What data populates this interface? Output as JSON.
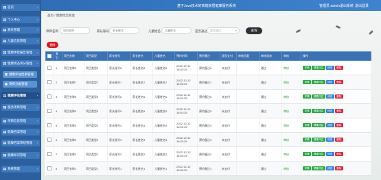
{
  "header": {
    "title": "基于Java技术的高端家居健康服务系统",
    "user": "管理员 admin",
    "exit_label": "退出系统",
    "logout_label": "退出登录"
  },
  "sidebar": {
    "items": [
      {
        "label": "首页"
      },
      {
        "label": "个人中心"
      },
      {
        "label": "家长管理"
      },
      {
        "label": "儿童信息管理"
      },
      {
        "label": "健康体检报告管理"
      },
      {
        "label": "健康状态评分管理"
      },
      {
        "label": "健康评估结果管理"
      },
      {
        "label": "项目分类管理"
      },
      {
        "label": "健康评估管理"
      },
      {
        "label": "服务项目管理"
      },
      {
        "label": "项目信息管理"
      },
      {
        "label": "健康档案管理"
      },
      {
        "label": "健康档案审核管理"
      },
      {
        "label": "健康知识管理"
      },
      {
        "label": "系统管理"
      }
    ]
  },
  "breadcrumb": {
    "home": "首页",
    "current": "健康档案管理"
  },
  "search": {
    "fields": [
      {
        "label": "项目名称",
        "placeholder": "项目名称"
      },
      {
        "label": "家长账号",
        "placeholder": "家长账号"
      },
      {
        "label": "儿童姓名",
        "placeholder": "儿童姓名"
      }
    ],
    "select_label": "是否通过",
    "select_placeholder": "是否通过",
    "query_button": "查询",
    "delete_button": "删除"
  },
  "table": {
    "columns": [
      "索引",
      "项目名称",
      "项目类型",
      "家长账号",
      "家长姓名",
      "儿童姓名",
      "预约时间",
      "预约备注",
      "是否支付",
      "审核回复",
      "审核状态",
      "审核",
      "操作"
    ],
    "rows": [
      [
        "1",
        "项目名称8",
        "项目类型8",
        "家长账号8",
        "家长姓名8",
        "儿童姓名8",
        "2022-12-12 16:53:25",
        "预约备注8",
        "未支付",
        "",
        "通过",
        "审核"
      ],
      [
        "2",
        "项目名称7",
        "项目类型7",
        "家长账号7",
        "家长姓名7",
        "儿童姓名7",
        "2022-12-12 16:53:25",
        "预约备注7",
        "未支付",
        "",
        "通过",
        "审核"
      ],
      [
        "3",
        "项目名称6",
        "项目类型6",
        "家长账号6",
        "家长姓名6",
        "儿童姓名6",
        "2022-12-12 16:53:25",
        "预约备注6",
        "未支付",
        "",
        "通过",
        "审核"
      ],
      [
        "4",
        "项目名称5",
        "项目类型5",
        "家长账号5",
        "家长姓名5",
        "儿童姓名5",
        "2022-12-12 16:53:25",
        "预约备注5",
        "未支付",
        "",
        "通过",
        "审核"
      ],
      [
        "5",
        "项目名称4",
        "项目类型4",
        "家长账号4",
        "家长姓名4",
        "儿童姓名4",
        "2022-12-12 16:53:25",
        "预约备注4",
        "未支付",
        "",
        "通过",
        "审核"
      ],
      [
        "6",
        "项目名称3",
        "项目类型3",
        "家长账号3",
        "家长姓名3",
        "儿童姓名3",
        "2022-12-12 16:53:25",
        "预约备注3",
        "未支付",
        "",
        "通过",
        "审核"
      ],
      [
        "7",
        "项目名称2",
        "项目类型2",
        "家长账号2",
        "家长姓名2",
        "儿童姓名2",
        "2022-12-12 16:53:25",
        "预约备注2",
        "未支付",
        "",
        "通过",
        "审核"
      ],
      [
        "8",
        "项目名称1",
        "项目类型1",
        "家长账号1",
        "家长姓名1",
        "儿童姓名1",
        "2022-12-12 16:53:25",
        "预约备注1",
        "未支付",
        "",
        "通过",
        "审核"
      ]
    ],
    "actions": {
      "detail": "详情",
      "evaluate": "健康评估",
      "edit": "修改",
      "delete": "删除"
    }
  },
  "colors": {
    "primary": "#3a72b6",
    "sidebar": "#2c5f9d",
    "danger": "#e0161e",
    "success": "#27a843"
  }
}
